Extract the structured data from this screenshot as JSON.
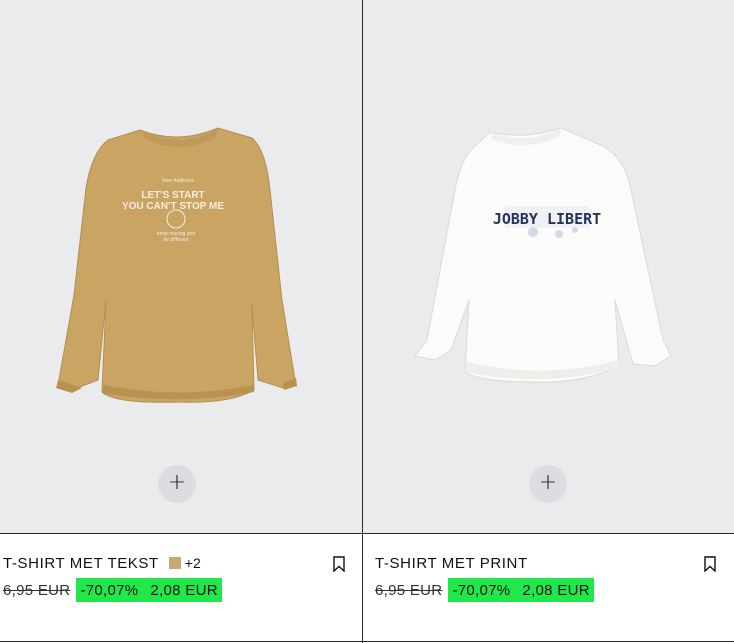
{
  "products": [
    {
      "name": "T-SHIRT MET TEKST",
      "color_swatch": "#c7a877",
      "more_colors": "+2",
      "old_price": "6,95 EUR",
      "discount": "-70,07%",
      "new_price": "2,08 EUR",
      "print_lines": [
        "New Additions",
        "LET'S START",
        "YOU CAN'T STOP ME",
        "keep moving and",
        "be different"
      ],
      "add_icon": "plus-icon",
      "bookmark_icon": "bookmark-icon"
    },
    {
      "name": "T-SHIRT MET PRINT",
      "old_price": "6,95 EUR",
      "discount": "-70,07%",
      "new_price": "2,08 EUR",
      "print_text": "JOBBY LIBERT",
      "add_icon": "plus-icon",
      "bookmark_icon": "bookmark-icon"
    }
  ],
  "colors": {
    "background": "#eaebed",
    "sale_highlight": "#20e84a",
    "sweater_beige": "#c9a462",
    "sweater_white": "#fbfbfa"
  }
}
